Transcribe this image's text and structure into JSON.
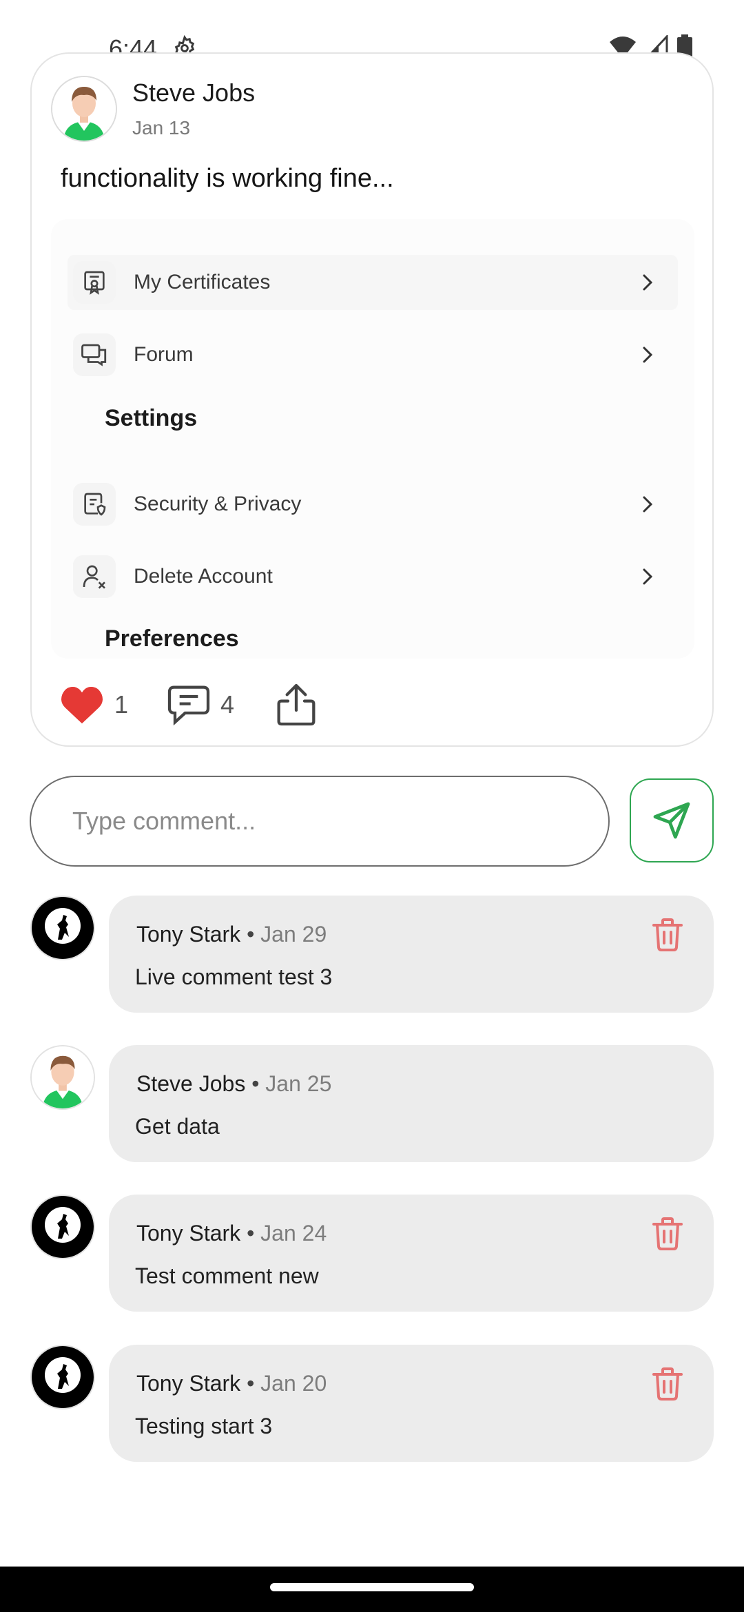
{
  "status_bar": {
    "time": "6:44"
  },
  "post": {
    "author": "Steve Jobs",
    "date": "Jan 13",
    "body": "functionality is working fine...",
    "embedded_menu": {
      "items": [
        {
          "label": "My Certificates",
          "icon": "certificate-icon"
        },
        {
          "label": "Forum",
          "icon": "forum-icon"
        },
        {
          "label": "Security & Privacy",
          "icon": "security-doc-icon"
        },
        {
          "label": "Delete Account",
          "icon": "delete-user-icon"
        }
      ],
      "settings_title": "Settings",
      "preferences_title": "Preferences"
    },
    "likes": "1",
    "comments_count": "4"
  },
  "comment_input": {
    "placeholder": "Type comment..."
  },
  "comments": [
    {
      "author": "Tony Stark",
      "date": "Jan 29",
      "text": "Live comment test 3",
      "deletable": true
    },
    {
      "author": "Steve Jobs",
      "date": "Jan 25",
      "text": "Get data",
      "deletable": false
    },
    {
      "author": "Tony Stark",
      "date": "Jan 24",
      "text": "Test comment new",
      "deletable": true
    },
    {
      "author": "Tony Stark",
      "date": "Jan 20",
      "text": "Testing start 3",
      "deletable": true
    }
  ],
  "colors": {
    "accent_green": "#2ea651",
    "heart_red": "#e53935",
    "delete_red": "#e57373"
  }
}
